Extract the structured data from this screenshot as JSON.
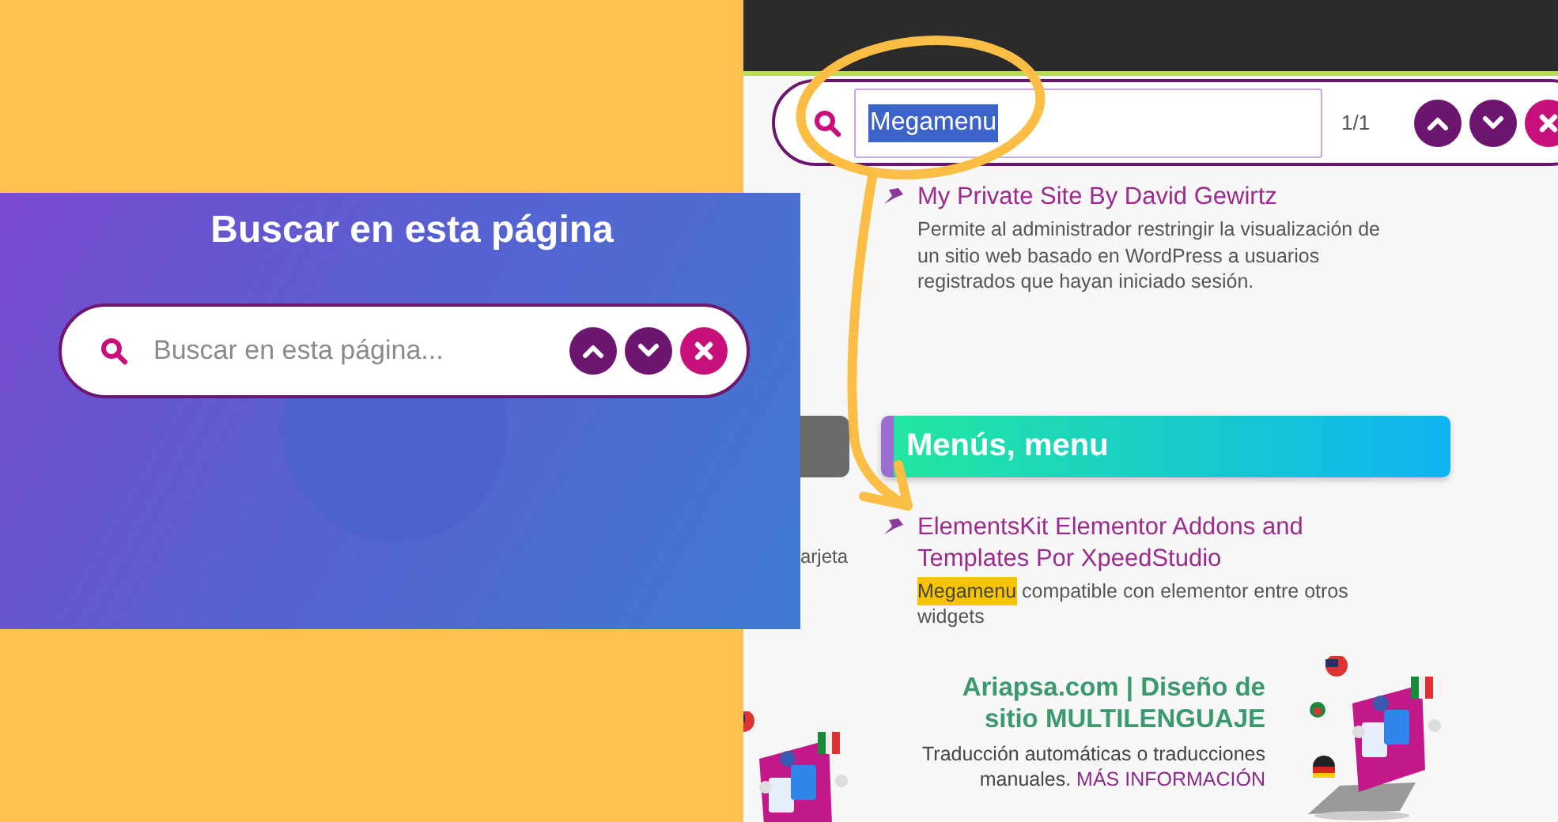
{
  "promo_panel": {
    "title": "Buscar en esta página",
    "search": {
      "placeholder": "Buscar en esta página..."
    }
  },
  "page": {
    "search": {
      "value": "Megamenu",
      "value_selected": true,
      "count": "1/1"
    },
    "results_top": [
      {
        "title": "My Private Site By David Gewirtz",
        "description": "Permite al administrador restringir la visualización de un sitio web basado en WordPress a usuarios registrados que hayan iniciado sesión."
      }
    ],
    "cut_text": "arjeta",
    "section": {
      "title": "Menús, menu"
    },
    "section_items": [
      {
        "title": "ElementsKit Elementor Addons and Templates Por XpeedStudio",
        "match": "Megamenu",
        "description": "compatible con elementor entre otros widgets"
      }
    ],
    "promo": {
      "title": "Ariapsa.com | Diseño de sitio MULTILENGUAJE",
      "text": "Traducción automáticas o traducciones manuales.",
      "link": "MÁS INFORMACIÓN"
    }
  }
}
